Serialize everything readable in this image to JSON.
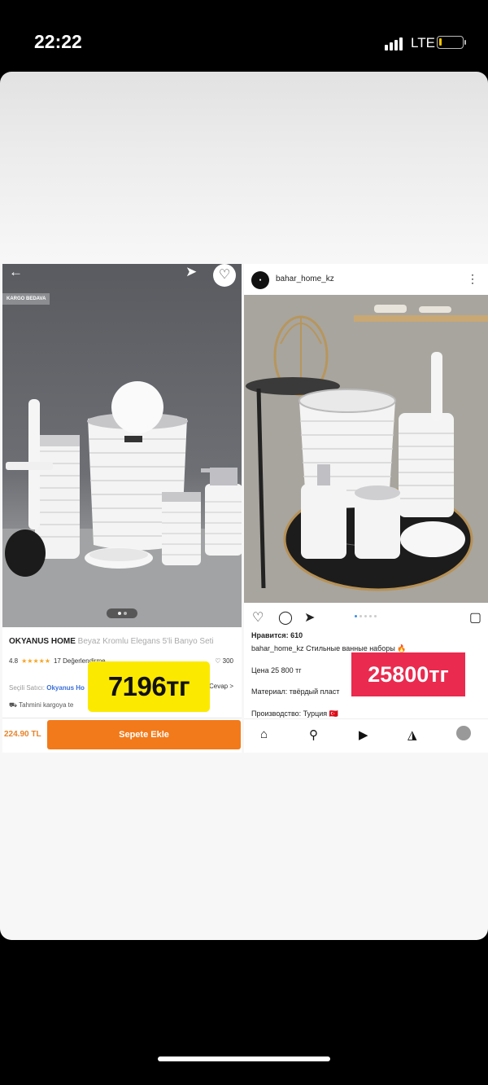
{
  "status_bar": {
    "time": "22:22",
    "network": "LTE"
  },
  "left_listing": {
    "badge": "KARGO BEDAVA",
    "brand": "OKYANUS HOME",
    "product_name": "Beyaz Kromlu Elegans 5'li Banyo Seti",
    "rating": "4.8",
    "stars": "★★★★★",
    "reviews": "17 Değerlendirme",
    "favorites": "300",
    "seller_label": "Seçili Satıcı:",
    "seller_name": "Okyanus Ho",
    "qa_link": "Cevap >",
    "shipping": "Tahmini kargoya te",
    "price": "224.90 TL",
    "add_to_cart": "Sepete Ekle",
    "price_overlay": "7196тг"
  },
  "right_post": {
    "username": "bahar_home_kz",
    "likes": "Нравится: 610",
    "caption_user": "bahar_home_kz",
    "caption_text": "Стильные ванные наборы 🔥",
    "price_line": "Цена 25 800 тг",
    "material_line": "Материал: твёрдый пласт",
    "origin_line": "Производство: Турция 🇹🇷",
    "price_overlay": "25800тг"
  }
}
